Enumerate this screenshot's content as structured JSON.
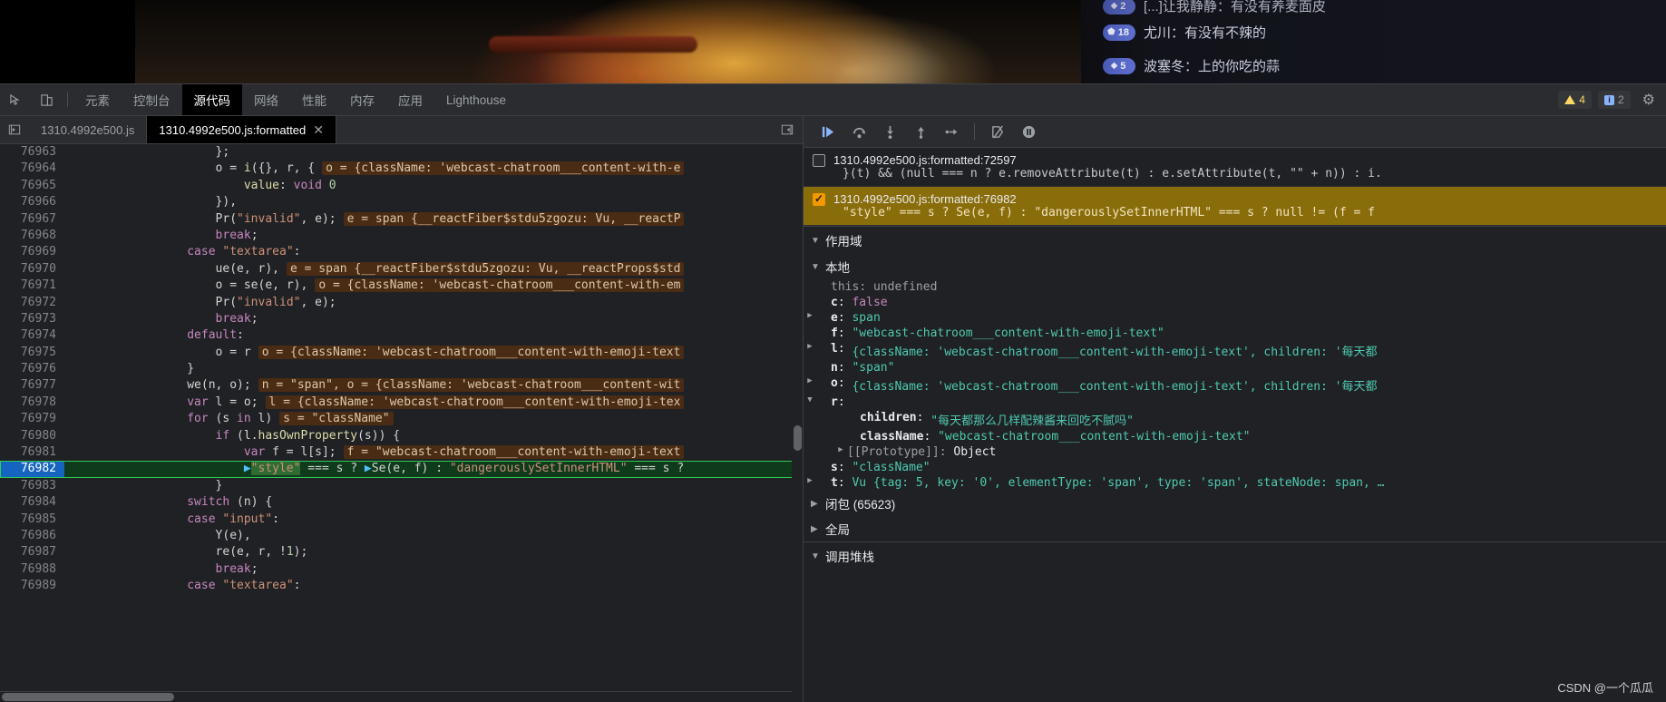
{
  "stream_chat": {
    "messages": [
      {
        "badge": "2",
        "gem": "◆",
        "text": "[...]让我静静：有没有养麦面皮",
        "partial": true
      },
      {
        "badge": "18",
        "gem": "⬟",
        "text": "尤川：有没有不辣的"
      },
      {
        "badge": "5",
        "gem": "◆",
        "text": "波塞冬：上的你吃的蒜"
      }
    ]
  },
  "devtools": {
    "toolbar_icons": [
      "inspect-icon",
      "device-toggle-icon"
    ],
    "panels": [
      {
        "label": "元素",
        "active": false
      },
      {
        "label": "控制台",
        "active": false
      },
      {
        "label": "源代码",
        "active": true
      },
      {
        "label": "网络",
        "active": false
      },
      {
        "label": "性能",
        "active": false
      },
      {
        "label": "内存",
        "active": false
      },
      {
        "label": "应用",
        "active": false
      },
      {
        "label": "Lighthouse",
        "active": false
      }
    ],
    "warning_count": "4",
    "error_count": "2",
    "settings_icon": "gear-icon"
  },
  "file_tabs": [
    {
      "label": "1310.4992e500.js",
      "active": false,
      "closable": false
    },
    {
      "label": "1310.4992e500.js:formatted",
      "active": true,
      "closable": true
    }
  ],
  "editor": {
    "lines": [
      {
        "n": "76963",
        "code": "                    };"
      },
      {
        "n": "76964",
        "code": "                    o = i({}, r, {",
        "chip": "o = {className: 'webcast-chatroom___content-with-e"
      },
      {
        "n": "76965",
        "code": "                        value: void 0"
      },
      {
        "n": "76966",
        "code": "                    }),",
        "chipless": true
      },
      {
        "n": "76967",
        "code": "                    Pr(\"invalid\", e);",
        "chip": "e = span {__reactFiber$stdu5zgozu: Vu, __reactP"
      },
      {
        "n": "76968",
        "code": "                    break;"
      },
      {
        "n": "76969",
        "code": "                case \"textarea\":"
      },
      {
        "n": "76970",
        "code": "                    ue(e, r),",
        "chip": "e = span {__reactFiber$stdu5zgozu: Vu, __reactProps$std"
      },
      {
        "n": "76971",
        "code": "                    o = se(e, r),",
        "chip": "o = {className: 'webcast-chatroom___content-with-em"
      },
      {
        "n": "76972",
        "code": "                    Pr(\"invalid\", e);"
      },
      {
        "n": "76973",
        "code": "                    break;"
      },
      {
        "n": "76974",
        "code": "                default:"
      },
      {
        "n": "76975",
        "code": "                    o = r",
        "chip": "o = {className: 'webcast-chatroom___content-with-emoji-text"
      },
      {
        "n": "76976",
        "code": "                }"
      },
      {
        "n": "76977",
        "code": "                we(n, o);",
        "chip": "n = \"span\", o = {className: 'webcast-chatroom___content-wit"
      },
      {
        "n": "76978",
        "code": "                var l = o;",
        "chip": "l = {className: 'webcast-chatroom___content-with-emoji-tex"
      },
      {
        "n": "76979",
        "code": "                for (s in l)",
        "chip": "s = \"className\""
      },
      {
        "n": "76980",
        "code": "                    if (l.hasOwnProperty(s)) {"
      },
      {
        "n": "76981",
        "code": "                        var f = l[s];",
        "chip": "f = \"webcast-chatroom___content-with-emoji-text"
      },
      {
        "n": "76982",
        "code": "                        \"style\" === s ? Se(e, f) : \"dangerouslySetInnerHTML\" === s ?",
        "exec": true
      },
      {
        "n": "76983",
        "code": "                    }"
      },
      {
        "n": "76984",
        "code": "                switch (n) {"
      },
      {
        "n": "76985",
        "code": "                case \"input\":"
      },
      {
        "n": "76986",
        "code": "                    Y(e),"
      },
      {
        "n": "76987",
        "code": "                    re(e, r, !1);"
      },
      {
        "n": "76988",
        "code": "                    break;"
      },
      {
        "n": "76989",
        "code": "                case \"textarea\":"
      }
    ]
  },
  "debugger": {
    "toolbar_buttons": [
      "resume-script-execution-icon",
      "step-over-icon",
      "step-into-icon",
      "step-out-icon",
      "step-icon",
      "deactivate-breakpoints-icon",
      "pause-on-exceptions-icon"
    ],
    "breakpoints": [
      {
        "checked": false,
        "location": "1310.4992e500.js:formatted:72597",
        "code": "}(t) && (null === n ? e.removeAttribute(t) : e.setAttribute(t, \"\" + n)) : i."
      },
      {
        "checked": true,
        "location": "1310.4992e500.js:formatted:76982",
        "code": "\"style\" === s ? Se(e, f) : \"dangerouslySetInnerHTML\" === s ? null != (f = f"
      }
    ],
    "scope_header": "作用域",
    "local_header": "本地",
    "variables": [
      {
        "arrow": "",
        "name": "this",
        "dim": true,
        "sep": ": ",
        "value": "undefined",
        "vtype": "dim"
      },
      {
        "arrow": "",
        "name": "c",
        "sep": ": ",
        "value": "false",
        "vtype": "kw"
      },
      {
        "arrow": "▶",
        "name": "e",
        "sep": ": ",
        "value": "span",
        "vtype": "obj"
      },
      {
        "arrow": "",
        "name": "f",
        "sep": ": ",
        "value": "\"webcast-chatroom___content-with-emoji-text\"",
        "vtype": "str"
      },
      {
        "arrow": "▶",
        "name": "l",
        "sep": ": ",
        "value": "{className: 'webcast-chatroom___content-with-emoji-text', children: '每天都",
        "vtype": "obj"
      },
      {
        "arrow": "",
        "name": "n",
        "sep": ": ",
        "value": "\"span\"",
        "vtype": "str"
      },
      {
        "arrow": "▶",
        "name": "o",
        "sep": ": ",
        "value": "{className: 'webcast-chatroom___content-with-emoji-text', children: '每天都",
        "vtype": "obj"
      },
      {
        "arrow": "▼",
        "name": "r",
        "sep": ":",
        "value": "",
        "vtype": "plain"
      }
    ],
    "r_children": [
      {
        "indent": 2,
        "arrow": "",
        "name": "children",
        "sep": ": ",
        "value": "\"每天都那么几样配辣酱来回吃不腻吗\"",
        "vtype": "str"
      },
      {
        "indent": 2,
        "arrow": "",
        "name": "className",
        "sep": ": ",
        "value": "\"webcast-chatroom___content-with-emoji-text\"",
        "vtype": "str"
      },
      {
        "indent": 2,
        "arrow": "▶",
        "name": "[[Prototype]]",
        "dim": true,
        "sep": ": ",
        "value": "Object",
        "vtype": "plain"
      }
    ],
    "variables_tail": [
      {
        "arrow": "",
        "name": "s",
        "sep": ": ",
        "value": "\"className\"",
        "vtype": "str"
      },
      {
        "arrow": "▶",
        "name": "t",
        "sep": ": ",
        "value": "Vu {tag: 5, key: '0', elementType: 'span', type: 'span', stateNode: span, …",
        "vtype": "obj"
      }
    ],
    "closure_header": "闭包 (65623)",
    "global_header": "全局",
    "callstack_header": "调用堆栈"
  },
  "watermark": "CSDN @一个瓜瓜",
  "colors": {
    "accent_blue": "#8ab4f8",
    "breakpoint_active": "#8a6d0b",
    "exec_line_bg": "#0f3a1b",
    "exec_line_border": "#2ecc54",
    "chip_bg": "#4a2c14",
    "panel_bg": "#202124"
  }
}
